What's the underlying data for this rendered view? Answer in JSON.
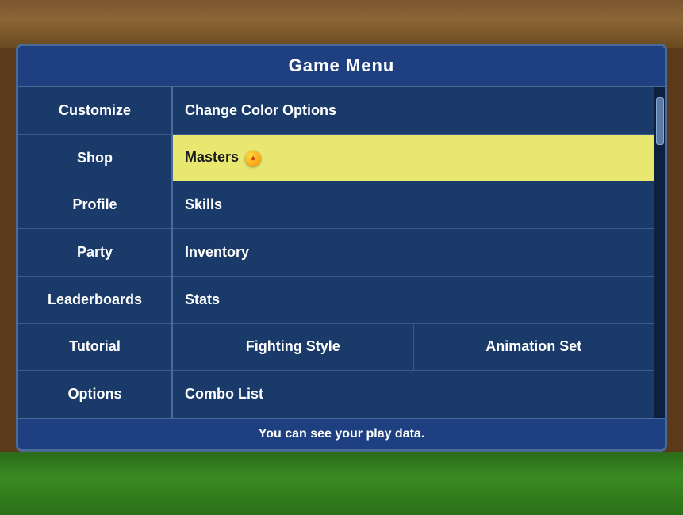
{
  "background": {
    "top_color": "#7a5530",
    "bottom_color": "#3a8a22"
  },
  "menu": {
    "title": "Game Menu",
    "nav_items": [
      {
        "id": "customize",
        "label": "Customize"
      },
      {
        "id": "shop",
        "label": "Shop"
      },
      {
        "id": "profile",
        "label": "Profile"
      },
      {
        "id": "party",
        "label": "Party"
      },
      {
        "id": "leaderboards",
        "label": "Leaderboards"
      },
      {
        "id": "tutorial",
        "label": "Tutorial"
      },
      {
        "id": "options",
        "label": "Options"
      }
    ],
    "content_rows": [
      {
        "id": "change-color",
        "label": "Change Color Options",
        "highlighted": false,
        "split": false
      },
      {
        "id": "masters",
        "label": "Masters",
        "highlighted": true,
        "split": false,
        "has_ball": true
      },
      {
        "id": "skills",
        "label": "Skills",
        "highlighted": false,
        "split": false
      },
      {
        "id": "inventory",
        "label": "Inventory",
        "highlighted": false,
        "split": false
      },
      {
        "id": "stats",
        "label": "Stats",
        "highlighted": false,
        "split": false
      },
      {
        "id": "fighting-animation",
        "split": true,
        "left": "Fighting Style",
        "right": "Animation Set"
      },
      {
        "id": "combo-list",
        "label": "Combo List",
        "highlighted": false,
        "split": false
      }
    ],
    "status_text": "You can see your play data."
  }
}
